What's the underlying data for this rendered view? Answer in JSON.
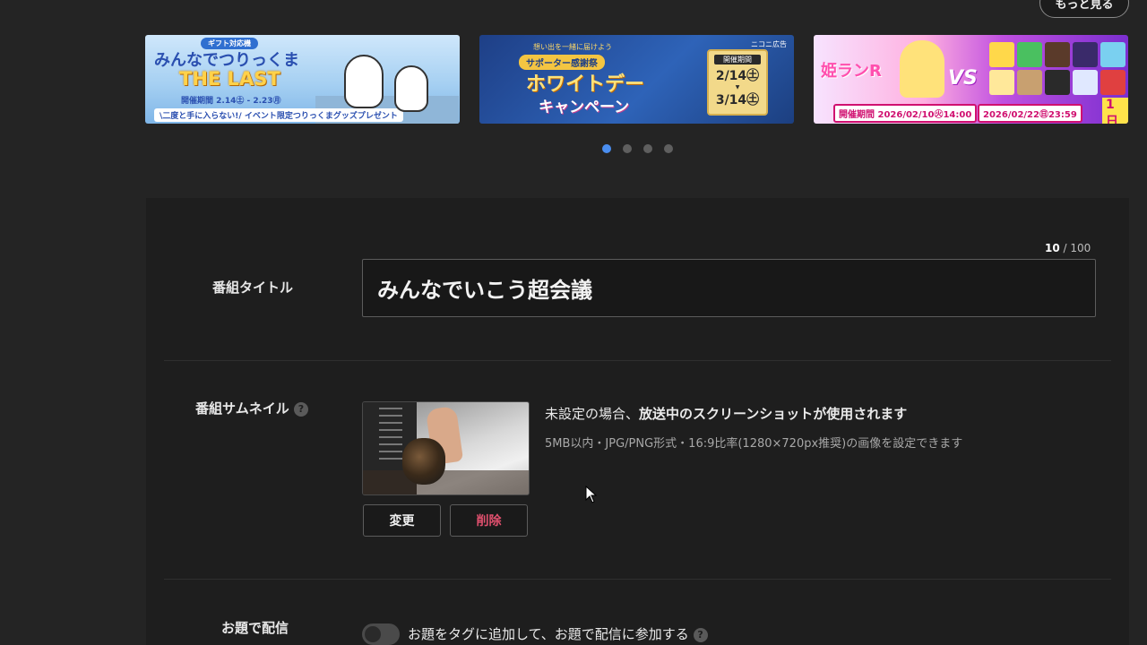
{
  "header": {
    "more_button": "もっと見る"
  },
  "banners": [
    {
      "tag": "ギフト対応機",
      "title": "みんなでつりっくま",
      "subtitle": "THE LAST",
      "period": "開催期間 2.14㊏ - 2.23㊊",
      "note": "\\二度と手に入らない!/ イベント限定つりっくまグッズプレゼント"
    },
    {
      "top": "想い出を一緒に届けよう",
      "pill": "サポーター感謝祭",
      "title": "ホワイトデー",
      "subtitle": "キャンペーン",
      "period_label": "開催期間",
      "start": "2/14㊏",
      "arrow": "▼",
      "end": "3/14㊏",
      "logo": "ニコニ広告"
    },
    {
      "title": "姫ランR",
      "vs": "VS",
      "date_start": "開催期間 2026/02/10㊋14:00",
      "date_end": "2026/02/22㊐23:59",
      "day_badge": "1日"
    }
  ],
  "carousel": {
    "active_index": 0,
    "count": 4
  },
  "form": {
    "title_counter_current": "10",
    "title_counter_sep": " / ",
    "title_counter_max": "100",
    "title_label": "番組タイトル",
    "title_value": "みんなでいこう超会議",
    "thumbnail_label": "番組サムネイル",
    "help_glyph": "?",
    "thumb_desc_prefix": "未設定の場合、",
    "thumb_desc_bold": "放送中のスクリーンショットが使用されます",
    "thumb_spec": "5MB以内・JPG/PNG形式・16:9比率(1280×720px推奨)の画像を設定できます",
    "change_button": "変更",
    "delete_button": "削除",
    "topic_label": "お題で配信",
    "topic_toggle_text": "お題をタグに追加して、お題で配信に参加する",
    "topic_toggle_on": false
  },
  "colors": {
    "background": "#242424",
    "panel": "#1e1e1e",
    "accent_dot": "#4a8ef0",
    "delete_text": "#e0506e"
  }
}
